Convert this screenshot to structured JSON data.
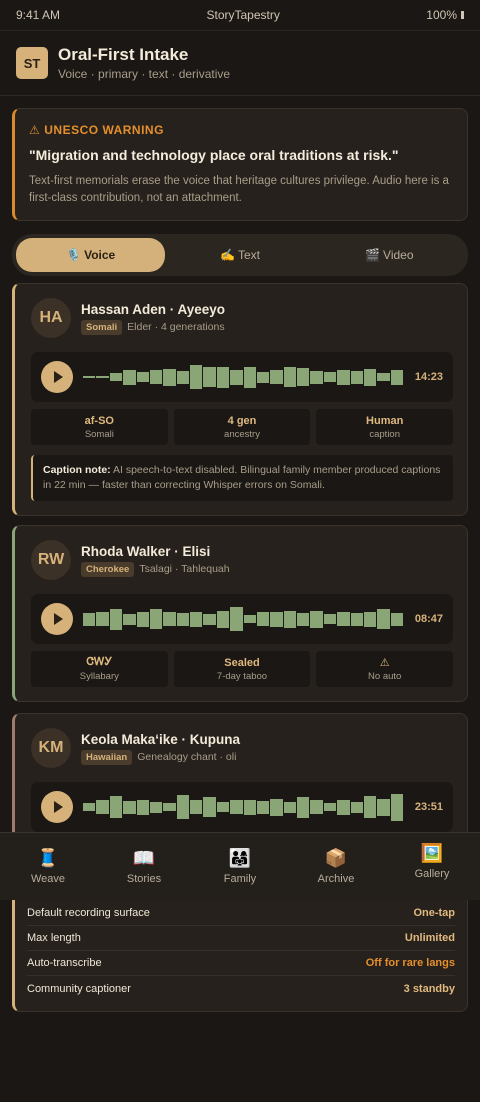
{
  "status": {
    "time": "9:41 AM",
    "app": "StoryTapestry",
    "battery": "100%"
  },
  "header": {
    "logo": "ST",
    "title": "Oral-First Intake",
    "subtitle": "Voice · primary · text · derivative"
  },
  "warning": {
    "icon": "⚠",
    "title": "UNESCO WARNING",
    "quote": "\"Migration and technology place oral traditions at risk.\"",
    "body": "Text-first memorials erase the voice that heritage cultures privilege. Audio here is a first-class contribution, not an attachment."
  },
  "segments": [
    {
      "icon": "🎙️",
      "label": "Voice"
    },
    {
      "icon": "✍️",
      "label": "Text"
    },
    {
      "icon": "🎬",
      "label": "Video"
    }
  ],
  "cards": [
    {
      "initials": "HA",
      "name": "Hassan Aden · Ayeeyo",
      "tag": "Somali",
      "meta": "Elder · 4 generations",
      "duration": "14:23",
      "waveform": [
        0.05,
        0.05,
        0.3,
        0.55,
        0.35,
        0.5,
        0.6,
        0.45,
        0.85,
        0.7,
        0.75,
        0.55,
        0.75,
        0.4,
        0.5,
        0.7,
        0.65,
        0.45,
        0.35,
        0.55,
        0.45,
        0.6,
        0.3,
        0.55
      ],
      "stats": [
        {
          "value": "af-SO",
          "label": "Somali"
        },
        {
          "value": "4 gen",
          "label": "ancestry"
        },
        {
          "value": "Human",
          "label": "caption"
        }
      ],
      "note_label": "Caption note:",
      "note_text": " AI speech-to-text disabled. Bilingual family member produced captions in 22 min — faster than correcting Whisper errors on Somali."
    },
    {
      "initials": "RW",
      "name": "Rhoda Walker · Elisi",
      "tag": "Cherokee",
      "meta": "Tsalagi · Tahlequah",
      "duration": "08:47",
      "waveform": [
        0.45,
        0.5,
        0.75,
        0.4,
        0.55,
        0.7,
        0.5,
        0.45,
        0.55,
        0.4,
        0.6,
        0.85,
        0.3,
        0.5,
        0.55,
        0.6,
        0.45,
        0.6,
        0.35,
        0.5,
        0.45,
        0.55,
        0.7,
        0.45
      ],
      "stats": [
        {
          "value": "ᏣᎳᎩ",
          "label": "Syllabary"
        },
        {
          "value": "Sealed",
          "label": "7-day taboo"
        },
        {
          "value": "⚠",
          "label": "No auto"
        }
      ]
    },
    {
      "initials": "KM",
      "name": "Keola Makaʻike · Kupuna",
      "tag": "Hawaiian",
      "meta": "Genealogy chant · oli",
      "duration": "23:51",
      "waveform": [
        0.3,
        0.5,
        0.8,
        0.45,
        0.55,
        0.4,
        0.3,
        0.85,
        0.5,
        0.7,
        0.35,
        0.5,
        0.55,
        0.45,
        0.6,
        0.4,
        0.75,
        0.5,
        0.3,
        0.55,
        0.4,
        0.8,
        0.6,
        0.95
      ]
    }
  ],
  "tabs": [
    {
      "icon": "🧵",
      "label": "Weave"
    },
    {
      "icon": "📖",
      "label": "Stories"
    },
    {
      "icon": "👨‍👩‍👧",
      "label": "Family"
    },
    {
      "icon": "📦",
      "label": "Archive"
    },
    {
      "icon": "🖼️",
      "label": "Gallery"
    }
  ],
  "settings": [
    {
      "key": "Default recording surface",
      "value": "One-tap"
    },
    {
      "key": "Max length",
      "value": "Unlimited"
    },
    {
      "key": "Auto-transcribe",
      "value": "Off for rare langs",
      "accent": "orange"
    },
    {
      "key": "Community captioner",
      "value": "3 standby"
    }
  ],
  "colors": {
    "accent": "#d6b27a",
    "warning": "#e58f2c",
    "wave": "#8aa677",
    "background": "#1a1714"
  }
}
